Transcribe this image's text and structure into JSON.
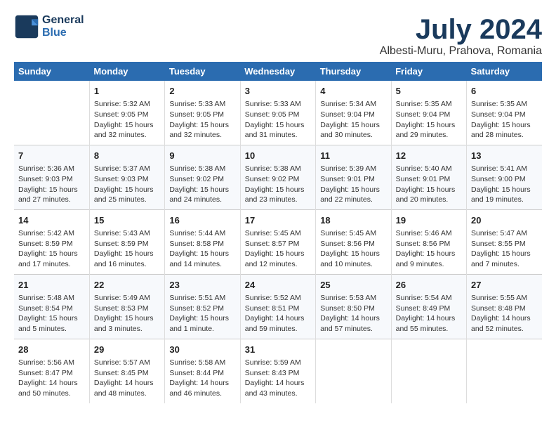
{
  "logo": {
    "line1": "General",
    "line2": "Blue"
  },
  "title": "July 2024",
  "subtitle": "Albesti-Muru, Prahova, Romania",
  "weekdays": [
    "Sunday",
    "Monday",
    "Tuesday",
    "Wednesday",
    "Thursday",
    "Friday",
    "Saturday"
  ],
  "weeks": [
    [
      {
        "day": "",
        "info": ""
      },
      {
        "day": "1",
        "info": "Sunrise: 5:32 AM\nSunset: 9:05 PM\nDaylight: 15 hours\nand 32 minutes."
      },
      {
        "day": "2",
        "info": "Sunrise: 5:33 AM\nSunset: 9:05 PM\nDaylight: 15 hours\nand 32 minutes."
      },
      {
        "day": "3",
        "info": "Sunrise: 5:33 AM\nSunset: 9:05 PM\nDaylight: 15 hours\nand 31 minutes."
      },
      {
        "day": "4",
        "info": "Sunrise: 5:34 AM\nSunset: 9:04 PM\nDaylight: 15 hours\nand 30 minutes."
      },
      {
        "day": "5",
        "info": "Sunrise: 5:35 AM\nSunset: 9:04 PM\nDaylight: 15 hours\nand 29 minutes."
      },
      {
        "day": "6",
        "info": "Sunrise: 5:35 AM\nSunset: 9:04 PM\nDaylight: 15 hours\nand 28 minutes."
      }
    ],
    [
      {
        "day": "7",
        "info": "Sunrise: 5:36 AM\nSunset: 9:03 PM\nDaylight: 15 hours\nand 27 minutes."
      },
      {
        "day": "8",
        "info": "Sunrise: 5:37 AM\nSunset: 9:03 PM\nDaylight: 15 hours\nand 25 minutes."
      },
      {
        "day": "9",
        "info": "Sunrise: 5:38 AM\nSunset: 9:02 PM\nDaylight: 15 hours\nand 24 minutes."
      },
      {
        "day": "10",
        "info": "Sunrise: 5:38 AM\nSunset: 9:02 PM\nDaylight: 15 hours\nand 23 minutes."
      },
      {
        "day": "11",
        "info": "Sunrise: 5:39 AM\nSunset: 9:01 PM\nDaylight: 15 hours\nand 22 minutes."
      },
      {
        "day": "12",
        "info": "Sunrise: 5:40 AM\nSunset: 9:01 PM\nDaylight: 15 hours\nand 20 minutes."
      },
      {
        "day": "13",
        "info": "Sunrise: 5:41 AM\nSunset: 9:00 PM\nDaylight: 15 hours\nand 19 minutes."
      }
    ],
    [
      {
        "day": "14",
        "info": "Sunrise: 5:42 AM\nSunset: 8:59 PM\nDaylight: 15 hours\nand 17 minutes."
      },
      {
        "day": "15",
        "info": "Sunrise: 5:43 AM\nSunset: 8:59 PM\nDaylight: 15 hours\nand 16 minutes."
      },
      {
        "day": "16",
        "info": "Sunrise: 5:44 AM\nSunset: 8:58 PM\nDaylight: 15 hours\nand 14 minutes."
      },
      {
        "day": "17",
        "info": "Sunrise: 5:45 AM\nSunset: 8:57 PM\nDaylight: 15 hours\nand 12 minutes."
      },
      {
        "day": "18",
        "info": "Sunrise: 5:45 AM\nSunset: 8:56 PM\nDaylight: 15 hours\nand 10 minutes."
      },
      {
        "day": "19",
        "info": "Sunrise: 5:46 AM\nSunset: 8:56 PM\nDaylight: 15 hours\nand 9 minutes."
      },
      {
        "day": "20",
        "info": "Sunrise: 5:47 AM\nSunset: 8:55 PM\nDaylight: 15 hours\nand 7 minutes."
      }
    ],
    [
      {
        "day": "21",
        "info": "Sunrise: 5:48 AM\nSunset: 8:54 PM\nDaylight: 15 hours\nand 5 minutes."
      },
      {
        "day": "22",
        "info": "Sunrise: 5:49 AM\nSunset: 8:53 PM\nDaylight: 15 hours\nand 3 minutes."
      },
      {
        "day": "23",
        "info": "Sunrise: 5:51 AM\nSunset: 8:52 PM\nDaylight: 15 hours\nand 1 minute."
      },
      {
        "day": "24",
        "info": "Sunrise: 5:52 AM\nSunset: 8:51 PM\nDaylight: 14 hours\nand 59 minutes."
      },
      {
        "day": "25",
        "info": "Sunrise: 5:53 AM\nSunset: 8:50 PM\nDaylight: 14 hours\nand 57 minutes."
      },
      {
        "day": "26",
        "info": "Sunrise: 5:54 AM\nSunset: 8:49 PM\nDaylight: 14 hours\nand 55 minutes."
      },
      {
        "day": "27",
        "info": "Sunrise: 5:55 AM\nSunset: 8:48 PM\nDaylight: 14 hours\nand 52 minutes."
      }
    ],
    [
      {
        "day": "28",
        "info": "Sunrise: 5:56 AM\nSunset: 8:47 PM\nDaylight: 14 hours\nand 50 minutes."
      },
      {
        "day": "29",
        "info": "Sunrise: 5:57 AM\nSunset: 8:45 PM\nDaylight: 14 hours\nand 48 minutes."
      },
      {
        "day": "30",
        "info": "Sunrise: 5:58 AM\nSunset: 8:44 PM\nDaylight: 14 hours\nand 46 minutes."
      },
      {
        "day": "31",
        "info": "Sunrise: 5:59 AM\nSunset: 8:43 PM\nDaylight: 14 hours\nand 43 minutes."
      },
      {
        "day": "",
        "info": ""
      },
      {
        "day": "",
        "info": ""
      },
      {
        "day": "",
        "info": ""
      }
    ]
  ]
}
